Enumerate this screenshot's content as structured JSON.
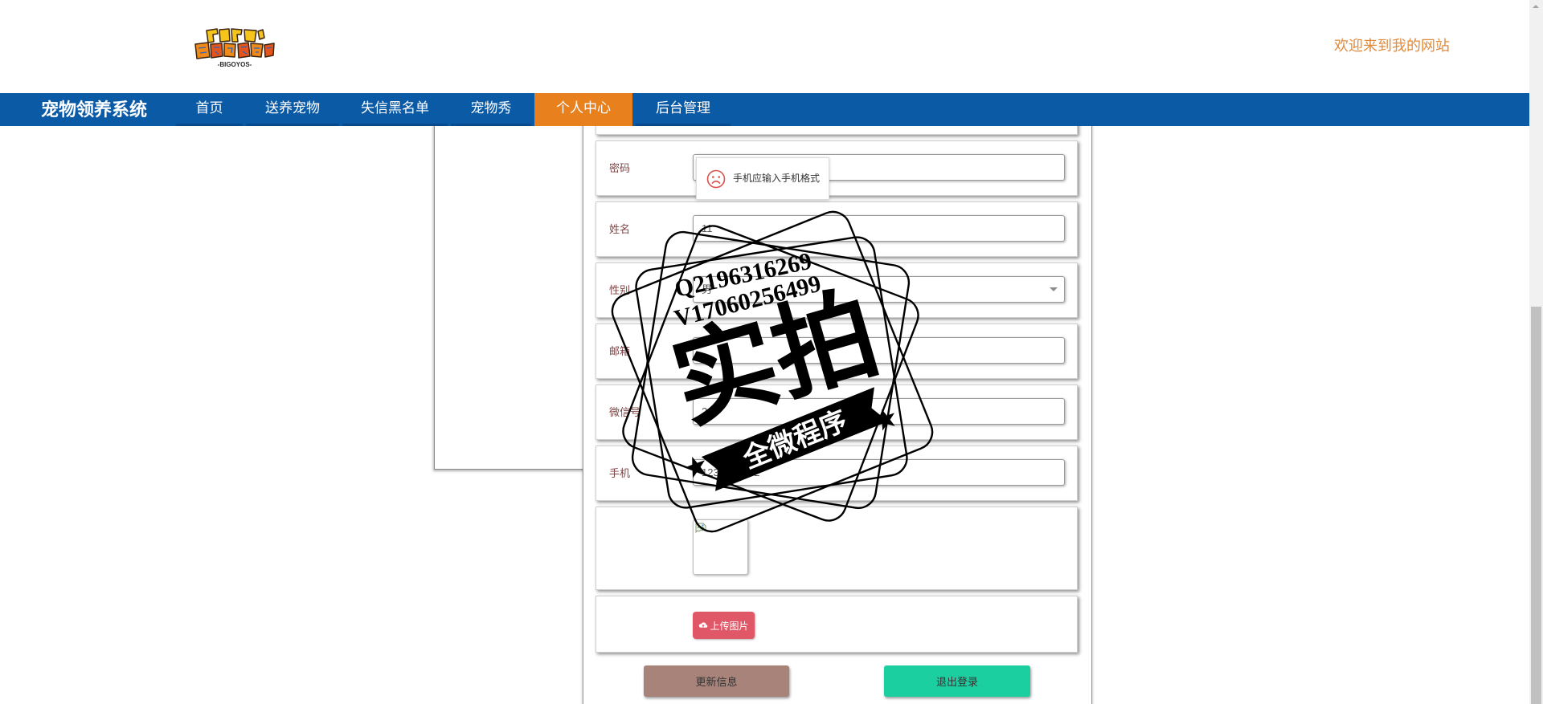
{
  "header": {
    "logo": {
      "subtext": "-BIGOYOS-"
    },
    "welcome": "欢迎来到我的网站"
  },
  "nav": {
    "brand": "宠物领养系统",
    "items": [
      {
        "label": "首页"
      },
      {
        "label": "送养宠物"
      },
      {
        "label": "失信黑名单"
      },
      {
        "label": "宠物秀"
      },
      {
        "label": "个人中心",
        "active": true
      },
      {
        "label": "后台管理"
      }
    ]
  },
  "form": {
    "fields": [
      {
        "label": "密码",
        "value": ""
      },
      {
        "label": "姓名",
        "value": "11"
      },
      {
        "label": "性别",
        "value": "男"
      },
      {
        "label": "邮箱",
        "value": ""
      },
      {
        "label": "微信号",
        "value": "2"
      },
      {
        "label": "手机",
        "value": "1234567892"
      }
    ],
    "upload_button": "上传图片",
    "update_button": "更新信息",
    "logout_button": "退出登录"
  },
  "tooltip": {
    "text": "手机应输入手机格式"
  },
  "watermark": {
    "line1": "Q2196316269",
    "line2": "V17060256499",
    "title": "实拍",
    "ribbon": "全微程序"
  },
  "icons": {
    "tooltip": "sad-face-icon",
    "upload": "cloud-upload-icon",
    "image": "broken-image-icon",
    "select": "chevron-down-icon",
    "scroll_up": "scroll-up-arrow-icon",
    "stamp": "star-icon"
  },
  "colors": {
    "nav_bg": "#0b5aa6",
    "nav_active": "#e9801e",
    "welcome_text": "#e08b3c",
    "field_label": "#7d4545",
    "upload_button": "#e05868",
    "update_button": "#a8837a",
    "logout_button": "#1ccfa1",
    "tooltip_icon": "#d9534f"
  }
}
